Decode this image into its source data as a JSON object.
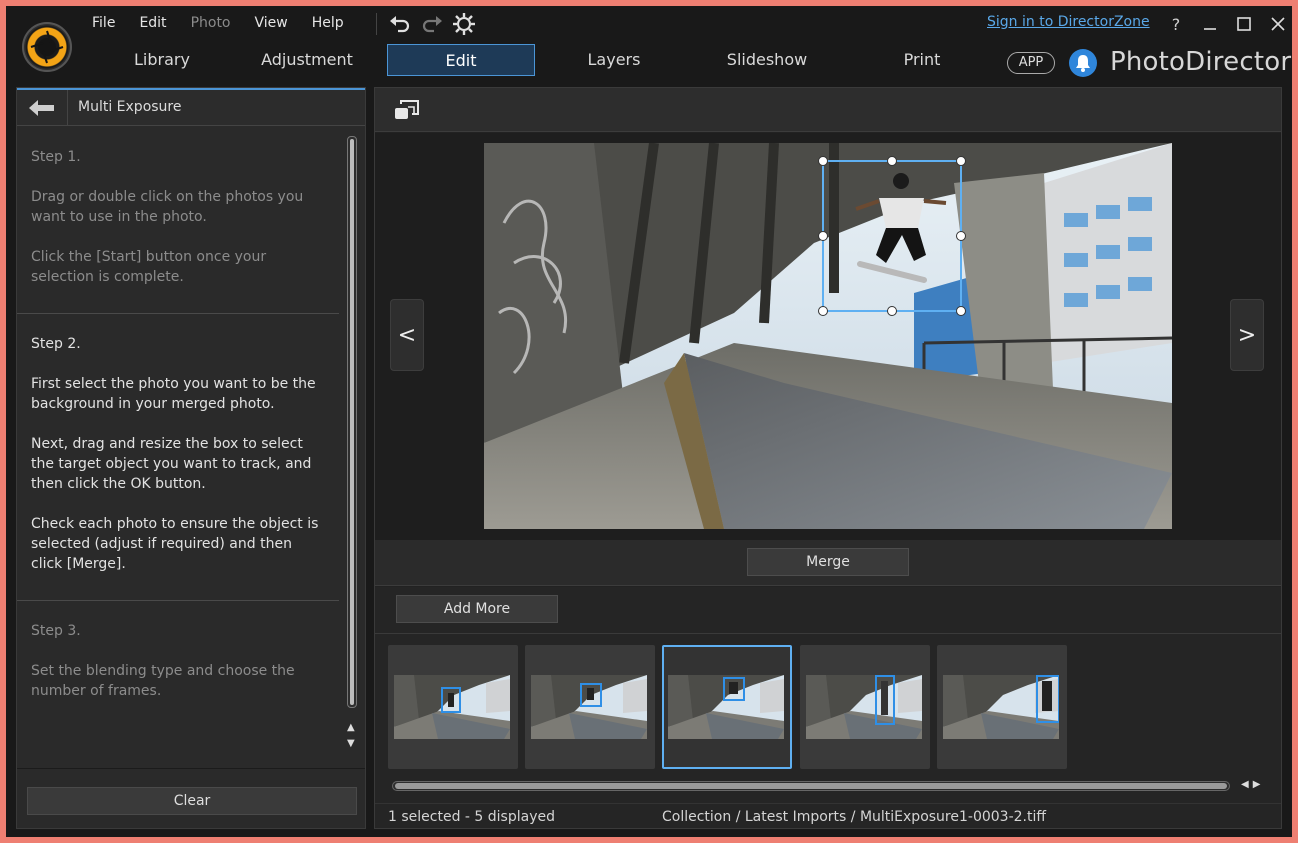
{
  "menu": {
    "items": [
      {
        "label": "File",
        "enabled": true
      },
      {
        "label": "Edit",
        "enabled": true
      },
      {
        "label": "Photo",
        "enabled": false
      },
      {
        "label": "View",
        "enabled": true
      },
      {
        "label": "Help",
        "enabled": true
      }
    ],
    "icons": [
      "undo-icon",
      "redo-icon",
      "settings-gear-icon"
    ]
  },
  "header": {
    "signin_label": "Sign in to DirectorZone",
    "help_glyph": "?",
    "app_badge": "APP",
    "brand": "PhotoDirector"
  },
  "tabs": [
    {
      "label": "Library",
      "active": false
    },
    {
      "label": "Adjustment",
      "active": false
    },
    {
      "label": "Edit",
      "active": true
    },
    {
      "label": "Layers",
      "active": false
    },
    {
      "label": "Slideshow",
      "active": false
    },
    {
      "label": "Print",
      "active": false
    }
  ],
  "left_panel": {
    "title": "Multi Exposure",
    "steps": [
      {
        "heading": "Step 1.",
        "active": false,
        "paragraphs": [
          "Drag or double click on the photos you want to use in the photo.",
          "Click the [Start] button once your selection is complete."
        ]
      },
      {
        "heading": "Step 2.",
        "active": true,
        "paragraphs": [
          "First select the photo you want to be the background in your merged photo.",
          "Next, drag and resize the box to select the target object you want to track, and then click the OK button.",
          "Check each photo to ensure the object is selected (adjust if required) and then click [Merge]."
        ]
      },
      {
        "heading": "Step 3.",
        "active": false,
        "paragraphs": [
          "Set the blending type and choose the number of frames."
        ]
      }
    ],
    "clear_label": "Clear"
  },
  "viewer": {
    "prev_label": "<",
    "next_label": ">",
    "merge_label": "Merge"
  },
  "strip": {
    "add_more_label": "Add More",
    "thumbnails": [
      {
        "selected": false
      },
      {
        "selected": false
      },
      {
        "selected": true
      },
      {
        "selected": false
      },
      {
        "selected": false
      }
    ]
  },
  "status": {
    "count_text": "1 selected - 5 displayed",
    "path_text": "Collection / Latest Imports / MultiExposure1-0003-2.tiff"
  },
  "colors": {
    "accent": "#4b95d6",
    "link": "#5aa8e8",
    "logo": "#f3a416",
    "selection_box": "#5fb0f2"
  }
}
